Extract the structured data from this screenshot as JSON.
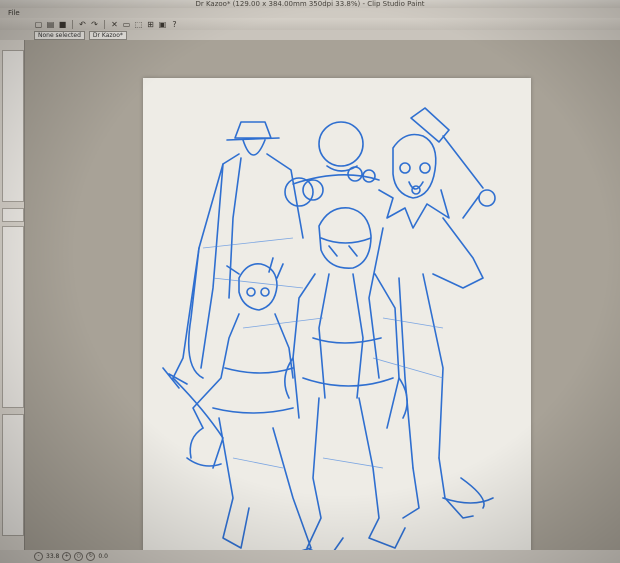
{
  "window": {
    "title": "Dr Kazoo* (129.00 x 384.00mm 350dpi 33.8%) - Clip Studio Paint"
  },
  "menubar": {
    "file_label": "File"
  },
  "toolbar": {
    "icons": [
      "new-icon",
      "open-icon",
      "save-icon",
      "undo-icon",
      "redo-icon",
      "delete-icon",
      "clear-icon",
      "transform-icon",
      "select-icon",
      "fill-icon",
      "help-icon"
    ]
  },
  "options": {
    "zoom_select": "None selected",
    "document_select": "Dr Kazoo*"
  },
  "statusbar": {
    "zoom": "33.8",
    "coords": "0.0"
  },
  "colors": {
    "sketch": "#2f6fd0",
    "paper": "#eeece6",
    "ui": "#cfcac2"
  }
}
